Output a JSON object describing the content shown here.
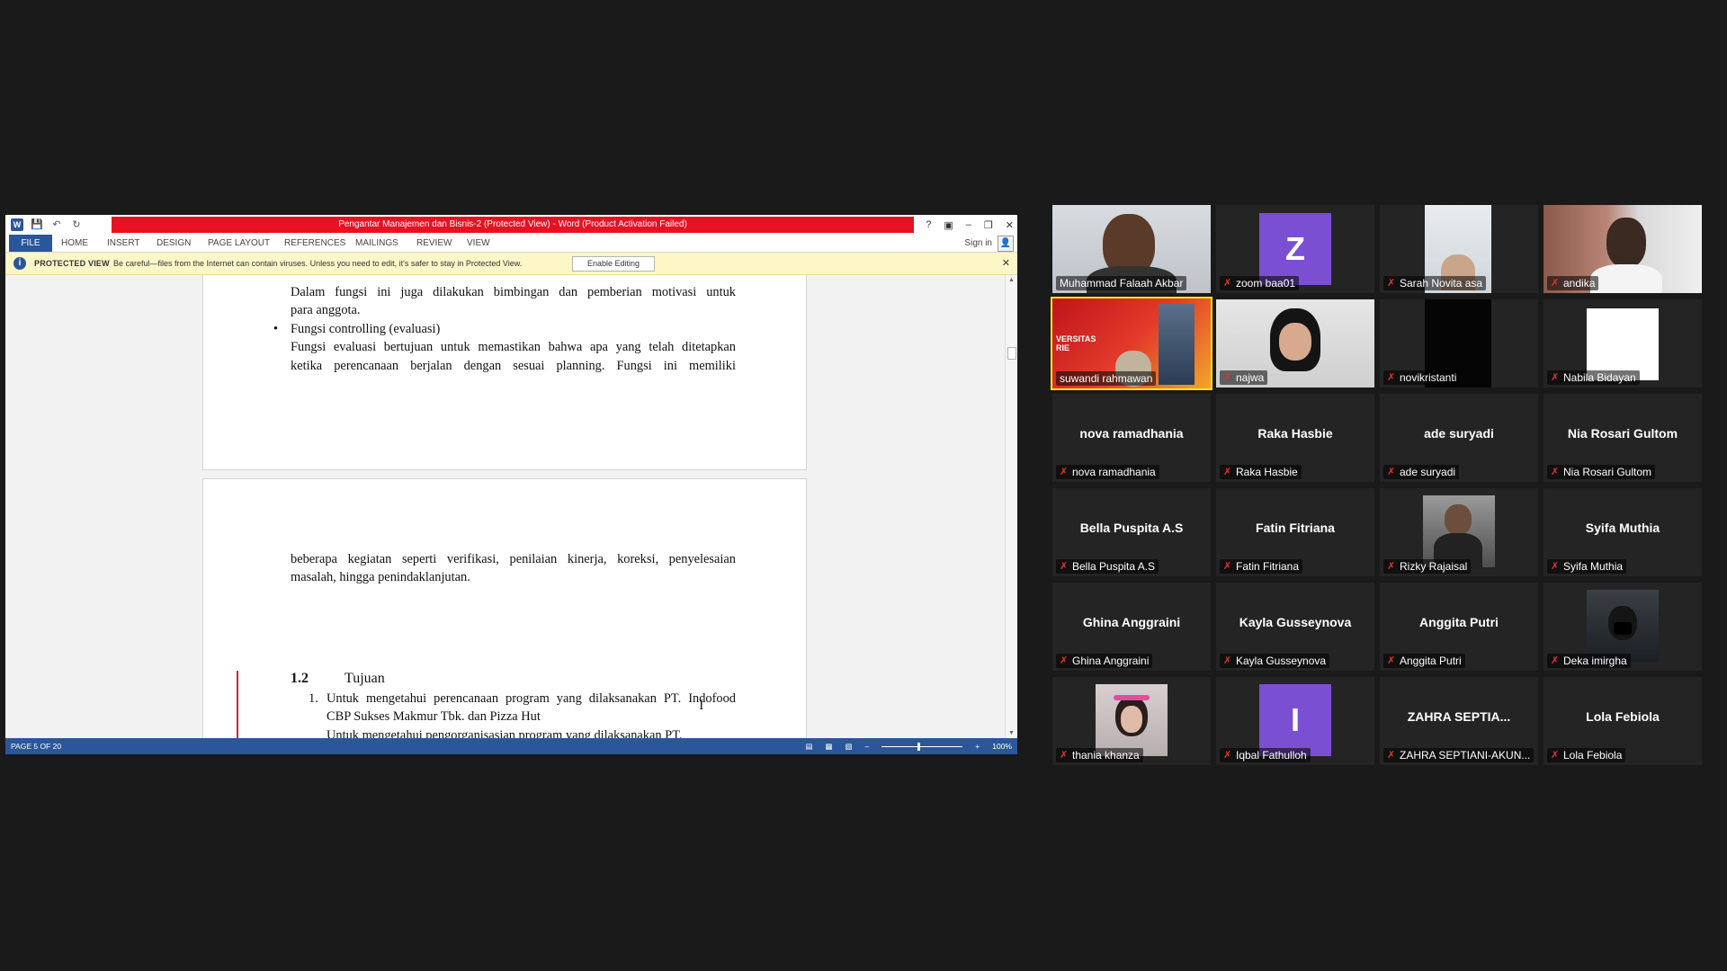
{
  "word": {
    "title": "Pengantar Manajemen dan Bisnis-2 (Protected View) - Word (Product Activation Failed)",
    "window_controls": [
      "?",
      "▣",
      "–",
      "❐",
      "✕"
    ],
    "ribbon_tabs": [
      "FILE",
      "HOME",
      "INSERT",
      "DESIGN",
      "PAGE LAYOUT",
      "REFERENCES",
      "MAILINGS",
      "REVIEW",
      "VIEW"
    ],
    "sign_in": "Sign in",
    "protected_view": {
      "label": "PROTECTED VIEW",
      "message": "Be careful—files from the Internet can contain viruses. Unless you need to edit, it's safer to stay in Protected View.",
      "button": "Enable Editing"
    },
    "page1": {
      "line1": "Dalam fungsi ini juga dilakukan bimbingan dan pemberian motivasi untuk",
      "line2": "para anggota.",
      "bullet": "Fungsi controlling (evaluasi)",
      "line3": "Fungsi evaluasi bertujuan untuk memastikan bahwa apa yang telah ditetapkan",
      "line4": "ketika perencanaan berjalan dengan sesuai planning. Fungsi ini memiliki"
    },
    "page2": {
      "line1": "beberapa kegiatan seperti verifikasi, penilaian kinerja, koreksi, penyelesaian",
      "line2": "masalah, hingga penindaklanjutan.",
      "heading_num": "1.2",
      "heading": "Tujuan",
      "item1_num": "1.",
      "item1_line1": "Untuk mengetahui perencanaan program yang dilaksanakan PT. Indofood",
      "item1_line2": "CBP Sukses Makmur Tbk. dan Pizza Hut",
      "item2_partial": "Untuk mengetahui pengorganisasian program yang dilaksanakan PT."
    },
    "status": {
      "page": "PAGE 5 OF 20",
      "zoom": "100%"
    }
  },
  "participants": [
    {
      "name": "Muhammad Falaah Akbar",
      "muted": false,
      "video": true
    },
    {
      "name": "zoom baa01",
      "muted": true,
      "avatar_letter": "Z"
    },
    {
      "name": "Sarah Novita asa",
      "muted": true,
      "video": true
    },
    {
      "name": "andika",
      "muted": true,
      "video": true
    },
    {
      "name": "suwandi rahmawan",
      "muted": false,
      "video": true,
      "active": true,
      "slide_text": "VERSITAS\nRIE"
    },
    {
      "name": "najwa",
      "muted": true,
      "video": true
    },
    {
      "name": "novikristanti",
      "muted": true,
      "video": true
    },
    {
      "name": "Nabila Bidayan",
      "muted": true,
      "video": true
    },
    {
      "name": "nova ramadhania",
      "muted": true
    },
    {
      "name": "Raka Hasbie",
      "muted": true
    },
    {
      "name": "ade suryadi",
      "muted": true
    },
    {
      "name": "Nia Rosari Gultom",
      "muted": true
    },
    {
      "name": "Bella Puspita A.S",
      "muted": true
    },
    {
      "name": "Fatin Fitriana",
      "muted": true
    },
    {
      "name": "Rizky Rajaisal",
      "muted": true,
      "video": true
    },
    {
      "name": "Syifa Muthia",
      "muted": true
    },
    {
      "name": "Ghina Anggraini",
      "muted": true
    },
    {
      "name": "Kayla Gusseynova",
      "muted": true
    },
    {
      "name": "Anggita Putri",
      "muted": true
    },
    {
      "name": "Deka imirgha",
      "muted": true,
      "video": true
    },
    {
      "name": "thania khanza",
      "muted": true,
      "video": true
    },
    {
      "name": "Iqbal Fathulloh",
      "muted": true,
      "avatar_letter": "I"
    },
    {
      "name": "ZAHRA SEPTIANI-AKUN...",
      "display_name": "ZAHRA SEPTIA...",
      "muted": true
    },
    {
      "name": "Lola Febiola",
      "muted": true
    }
  ],
  "colors": {
    "word_blue": "#2b579a",
    "title_red": "#e81123",
    "active_speaker": "#ffe41c",
    "muted_red": "#e0352b",
    "avatar_purple": "#7b4fd1"
  }
}
